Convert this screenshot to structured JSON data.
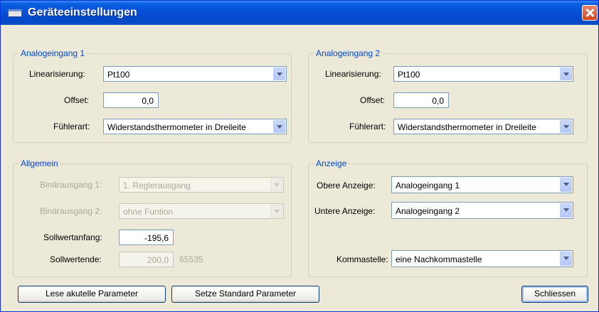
{
  "window": {
    "title": "Geräteeinstellungen"
  },
  "ain1": {
    "legend": "Analogeingang 1",
    "linearisierung_label": "Linearisierung:",
    "linearisierung_value": "Pt100",
    "offset_label": "Offset:",
    "offset_value": "0,0",
    "fuehlerart_label": "Fühlerart:",
    "fuehlerart_value": "Widerstandsthermometer in Dreileite"
  },
  "ain2": {
    "legend": "Analogeingang 2",
    "linearisierung_label": "Linearisierung:",
    "linearisierung_value": "Pt100",
    "offset_label": "Offset:",
    "offset_value": "0,0",
    "fuehlerart_label": "Fühlerart:",
    "fuehlerart_value": "Widerstandsthermometer in Dreileite"
  },
  "allgemein": {
    "legend": "Allgemein",
    "binaer1_label": "Binärausgang 1:",
    "binaer1_value": "1. Reglerausgang",
    "binaer2_label": "Binärausgang 2:",
    "binaer2_value": "ohne Funtion",
    "sollwertanfang_label": "Sollwertanfang:",
    "sollwertanfang_value": "-195,6",
    "sollwertende_label": "Sollwertende:",
    "sollwertende_value": "200,0",
    "sollwertende_extra": "65535"
  },
  "anzeige": {
    "legend": "Anzeige",
    "obere_label": "Obere Anzeige:",
    "obere_value": "Analogeingang 1",
    "untere_label": "Untere Anzeige:",
    "untere_value": "Analogeingang 2",
    "komma_label": "Kommastelle:",
    "komma_value": "eine Nachkommastelle"
  },
  "buttons": {
    "read": "Lese akutelle Parameter",
    "defaults": "Setze Standard Parameter",
    "close": "Schliessen"
  }
}
